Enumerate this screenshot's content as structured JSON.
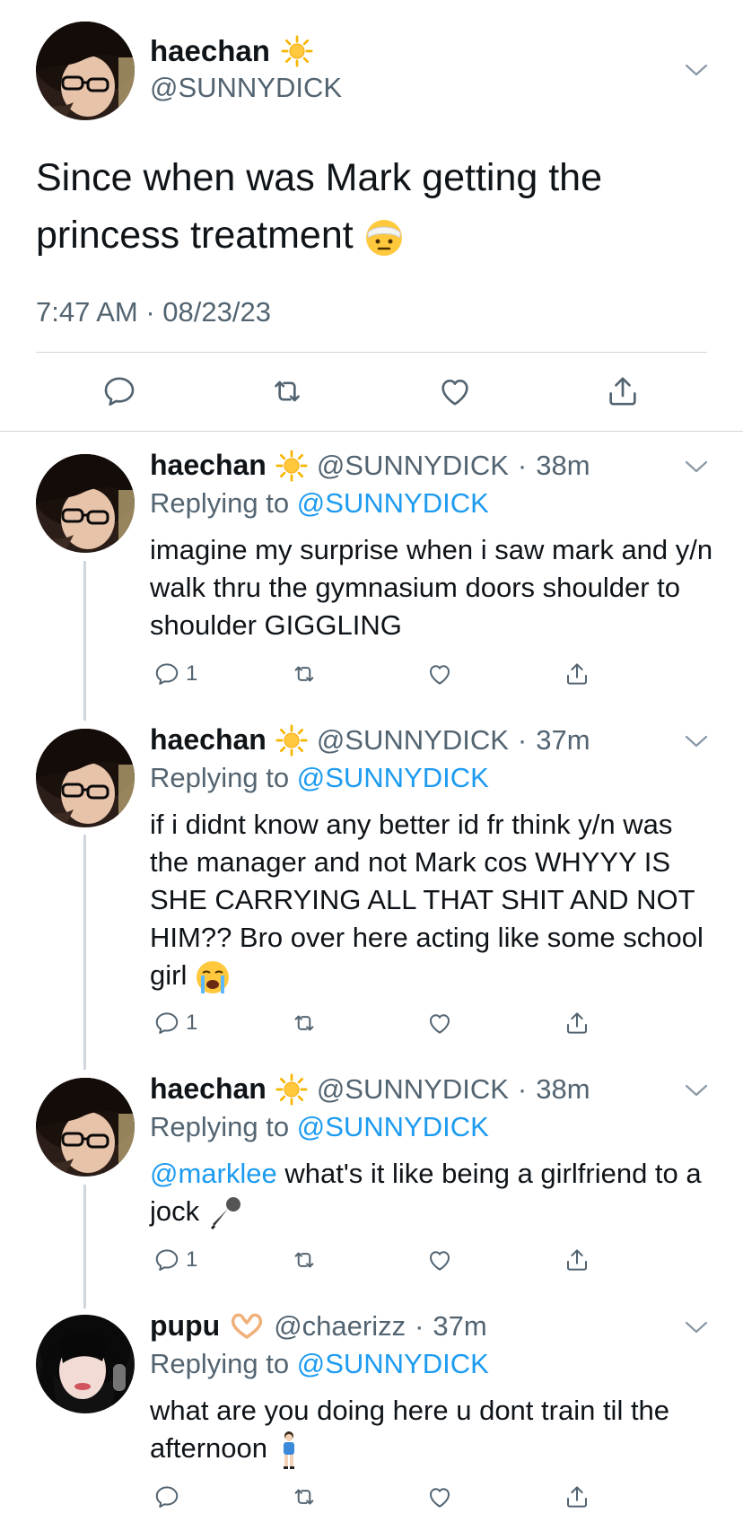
{
  "main_tweet": {
    "name": "haechan",
    "handle": "@SUNNYDICK",
    "text": "Since when was Mark getting the princess treatment",
    "timestamp": "7:47 AM · 08/23/23"
  },
  "replies": [
    {
      "name": "haechan",
      "handle": "@SUNNYDICK",
      "time": "38m",
      "replying_prefix": "Replying to",
      "replying_to": "@SUNNYDICK",
      "text": "imagine my surprise when i saw mark and y/n walk thru the gymnasium doors shoulder to shoulder GIGGLING",
      "reply_count": "1"
    },
    {
      "name": "haechan",
      "handle": "@SUNNYDICK",
      "time": "37m",
      "replying_prefix": "Replying to",
      "replying_to": "@SUNNYDICK",
      "text": "if i didnt know any better id fr think y/n was the manager and not Mark cos WHYYY IS SHE CARRYING ALL THAT SHIT AND NOT HIM?? Bro over here acting like some school girl",
      "reply_count": "1"
    },
    {
      "name": "haechan",
      "handle": "@SUNNYDICK",
      "time": "38m",
      "replying_prefix": "Replying to",
      "replying_to": "@SUNNYDICK",
      "mention": "@marklee",
      "text": "what's it like being a girlfriend to a jock",
      "reply_count": "1"
    },
    {
      "name": "pupu",
      "handle": "@chaerizz",
      "time": "37m",
      "replying_prefix": "Replying to",
      "replying_to": "@SUNNYDICK",
      "text": "what are you doing here u dont train til the afternoon",
      "reply_count": ""
    }
  ],
  "separator": "·",
  "icons": {
    "reply": "reply-icon",
    "retweet": "retweet-icon",
    "like": "heart-icon",
    "share": "share-icon",
    "more": "chevron-down-icon",
    "sun_emoji": "sun-emoji-icon",
    "bandage_emoji": "face-with-head-bandage-emoji",
    "crying_emoji": "loudly-crying-face-emoji",
    "mic_emoji": "microphone-emoji",
    "heart_hands_emoji": "heart-hands-emoji",
    "woman_emoji": "standing-woman-emoji"
  },
  "colors": {
    "link": "#1d9bf0",
    "muted": "#536471",
    "divider": "#cfd6dc"
  }
}
